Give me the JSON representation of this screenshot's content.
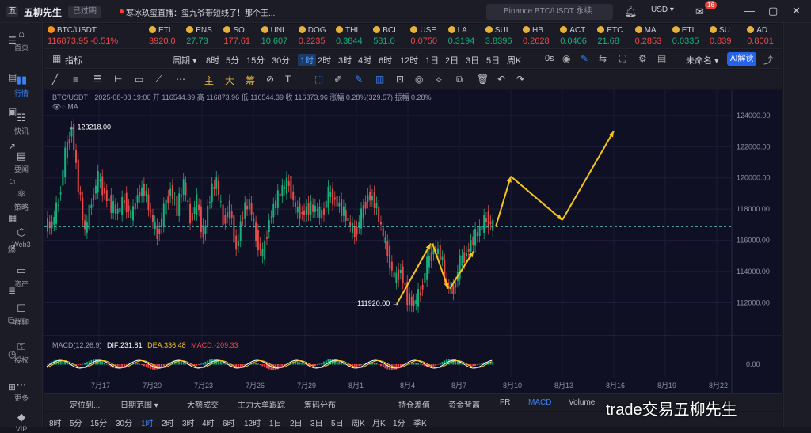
{
  "titlebar": {
    "app_name": "五柳先生",
    "status": "已过期",
    "live": "寒冰玖玺直播：玺九爷带短线了！那个王...",
    "search_placeholder": "Binance BTC/USDT 永续",
    "currency": "USD ▾",
    "mail_badge": "16",
    "min": "—",
    "max": "▢",
    "close": "✕"
  },
  "nav": [
    {
      "label": "首页"
    },
    {
      "label": "行情"
    },
    {
      "label": "快讯"
    },
    {
      "label": "要闻"
    },
    {
      "label": "策略"
    },
    {
      "label": "Web3"
    },
    {
      "label": "资产"
    },
    {
      "label": "群聊"
    },
    {
      "label": "授权"
    },
    {
      "label": "更多"
    },
    {
      "label": "VIP"
    }
  ],
  "ticker": {
    "main_symbol": "BTC/USDT",
    "main_price": "116873.95",
    "main_change": "-0.51%",
    "items": [
      {
        "sym": "ETI",
        "px": "3920.0"
      },
      {
        "sym": "ENS",
        "px": "27.73"
      },
      {
        "sym": "SO",
        "px": "177.61"
      },
      {
        "sym": "UNI",
        "px": "10.607"
      },
      {
        "sym": "DOG",
        "px": "0.2235"
      },
      {
        "sym": "THI",
        "px": "0.3844"
      },
      {
        "sym": "BCI",
        "px": "581.0"
      },
      {
        "sym": "USE",
        "px": "0.0750"
      },
      {
        "sym": "LA",
        "px": "0.3194"
      },
      {
        "sym": "SUI",
        "px": "3.8396"
      },
      {
        "sym": "HB",
        "px": "0.2628"
      },
      {
        "sym": "ACT",
        "px": "0.0406"
      },
      {
        "sym": "ETC",
        "px": "21.68"
      },
      {
        "sym": "MA",
        "px": "0.2853"
      },
      {
        "sym": "ETI",
        "px": "0.0335"
      },
      {
        "sym": "SU",
        "px": "0.839"
      },
      {
        "sym": "AD",
        "px": "0.8001"
      }
    ]
  },
  "toolbar1": {
    "indicators": "指标",
    "period": "周期 ▾",
    "periods": [
      "8时",
      "5分",
      "15分",
      "30分",
      "1时",
      "2时",
      "3时",
      "4时",
      "6时",
      "12时",
      "1日",
      "2日",
      "3日",
      "5日",
      "周K"
    ],
    "selected_period": "1时",
    "zero_s": "0s",
    "unnamed": "未命名 ▾",
    "ai": "AI解读"
  },
  "toolbar2": {
    "tools_a": [
      "主",
      "大",
      "筹"
    ]
  },
  "chart_header": {
    "symbol": "BTC/USDT",
    "info": "2025-08-08 19:00 开 116544.39 高 116873.96 低 116544.39 收 116873.96 涨幅 0.28%(329.57) 振幅 0.28%",
    "ma": "MA",
    "macd": "MACD(12,26,9)",
    "dif": "DIF:231.81",
    "dea": "DEA:336.48",
    "macd_val": "MACD:-209.33"
  },
  "chart_data": {
    "type": "candlestick",
    "x": [
      "7月17",
      "7月20",
      "7月23",
      "7月26",
      "7月29",
      "8月1",
      "8月4",
      "8月7",
      "8月10",
      "8月13",
      "8月16",
      "8月19",
      "8月22"
    ],
    "y_ticks": [
      112000,
      114000,
      116000,
      118000,
      120000,
      122000,
      124000
    ],
    "ylim": [
      110400,
      124600
    ],
    "close_series": [
      117000,
      118500,
      121500,
      123218,
      119500,
      116500,
      118500,
      120000,
      119000,
      118200,
      117800,
      118600,
      117500,
      118900,
      119300,
      117600,
      116300,
      117900,
      119300,
      118000,
      119700,
      117300,
      118500,
      116200,
      118900,
      119800,
      117200,
      118100,
      115400,
      117800,
      118400,
      116200,
      115000,
      117300,
      118500,
      119300,
      119700,
      118000,
      117700,
      118100,
      118000,
      117600,
      119000,
      118600,
      118000,
      117200,
      116400,
      117600,
      118900,
      118500,
      116800,
      115200,
      113500,
      114100,
      112300,
      111920,
      112700,
      114500,
      115400,
      115200,
      113100,
      112800,
      114600,
      115200,
      116100,
      116700,
      117400,
      116874
    ],
    "high_label": "123218.00",
    "low_label": "111920.00",
    "last_price": 116874,
    "projection": [
      [
        116874,
        "8月7"
      ],
      [
        120100,
        "8月10"
      ],
      [
        117300,
        "8月13"
      ],
      [
        123000,
        "8月16"
      ]
    ],
    "macd_zero": "0.00"
  },
  "bottom1": {
    "tabs": [
      "定位到...",
      "日期范围 ▾",
      "大额成交",
      "主力大单跟踪",
      "筹码分布",
      "持仓差值",
      "资金背离",
      "FR",
      "MACD",
      "Volume"
    ],
    "selected": "MACD"
  },
  "bottom2": {
    "periods": [
      "8时",
      "5分",
      "15分",
      "30分",
      "1时",
      "2时",
      "3时",
      "4时",
      "6时",
      "12时",
      "1日",
      "2日",
      "3日",
      "5日",
      "周K",
      "月K",
      "1分",
      "季K"
    ],
    "selected": "1时"
  },
  "watermark": "trade交易五柳先生",
  "colors": {
    "up": "#16b07d",
    "down": "#e84a4a",
    "accent": "#3b82f6",
    "arrow": "#f5c518"
  }
}
